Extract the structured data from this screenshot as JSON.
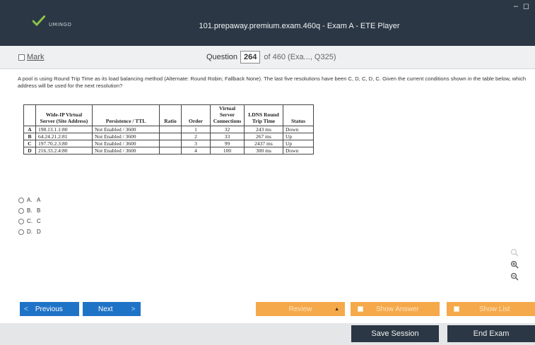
{
  "window": {
    "logo_text": "UMINGO",
    "title": "101.prepaway.premium.exam.460q - Exam A - ETE Player",
    "controls": "– ◻"
  },
  "question_bar": {
    "mark_label": "Mark",
    "question_word": "Question",
    "question_number": "264",
    "question_of": "of 460 (Exa..., Q325)"
  },
  "question": {
    "text": "A pool is using Round Trip Time as its load balancing method (Alternate: Round Robin; Fallback None). The last five resolutions have been C, D, C, D, C. Given the current conditions shown in the table below, which address will be used for the next resolution?"
  },
  "table": {
    "headers": [
      "",
      "Wide-IP Virtual Server (Site Address)",
      "Persistence / TTL",
      "Ratio",
      "Order",
      "Virtual Server Connections",
      "LDNS Round Trip Time",
      "Status"
    ],
    "rows": [
      [
        "A",
        "198.13.1.1:80",
        "Not Enabled / 3600",
        "",
        "1",
        "32",
        "243 ms",
        "Down"
      ],
      [
        "B",
        "64.24.21.2:81",
        "Not Enabled / 3600",
        "",
        "2",
        "33",
        "267 ms",
        "Up"
      ],
      [
        "C",
        "197.70.2.3:80",
        "Not Enabled / 3600",
        "",
        "3",
        "99",
        "2437 ms",
        "Up"
      ],
      [
        "D",
        "216.33.2.4:80",
        "Not Enabled / 3600",
        "",
        "4",
        "100",
        "300 ms",
        "Down"
      ]
    ]
  },
  "options": [
    {
      "letter": "A.",
      "text": "A"
    },
    {
      "letter": "B.",
      "text": "B"
    },
    {
      "letter": "C.",
      "text": "C"
    },
    {
      "letter": "D.",
      "text": "D"
    }
  ],
  "tools": {
    "search_icon": "magnifier",
    "zoom_in_icon": "zoom-in",
    "zoom_out_icon": "zoom-out"
  },
  "nav": {
    "previous": "Previous",
    "next": "Next",
    "review": "Review",
    "show_answer": "Show Answer",
    "show_list": "Show List"
  },
  "footer": {
    "save_session": "Save Session",
    "end_exam": "End Exam"
  },
  "colors": {
    "titlebar": "#2b3744",
    "nav_blue": "#1f73c7",
    "nav_orange": "#f5a94a"
  }
}
